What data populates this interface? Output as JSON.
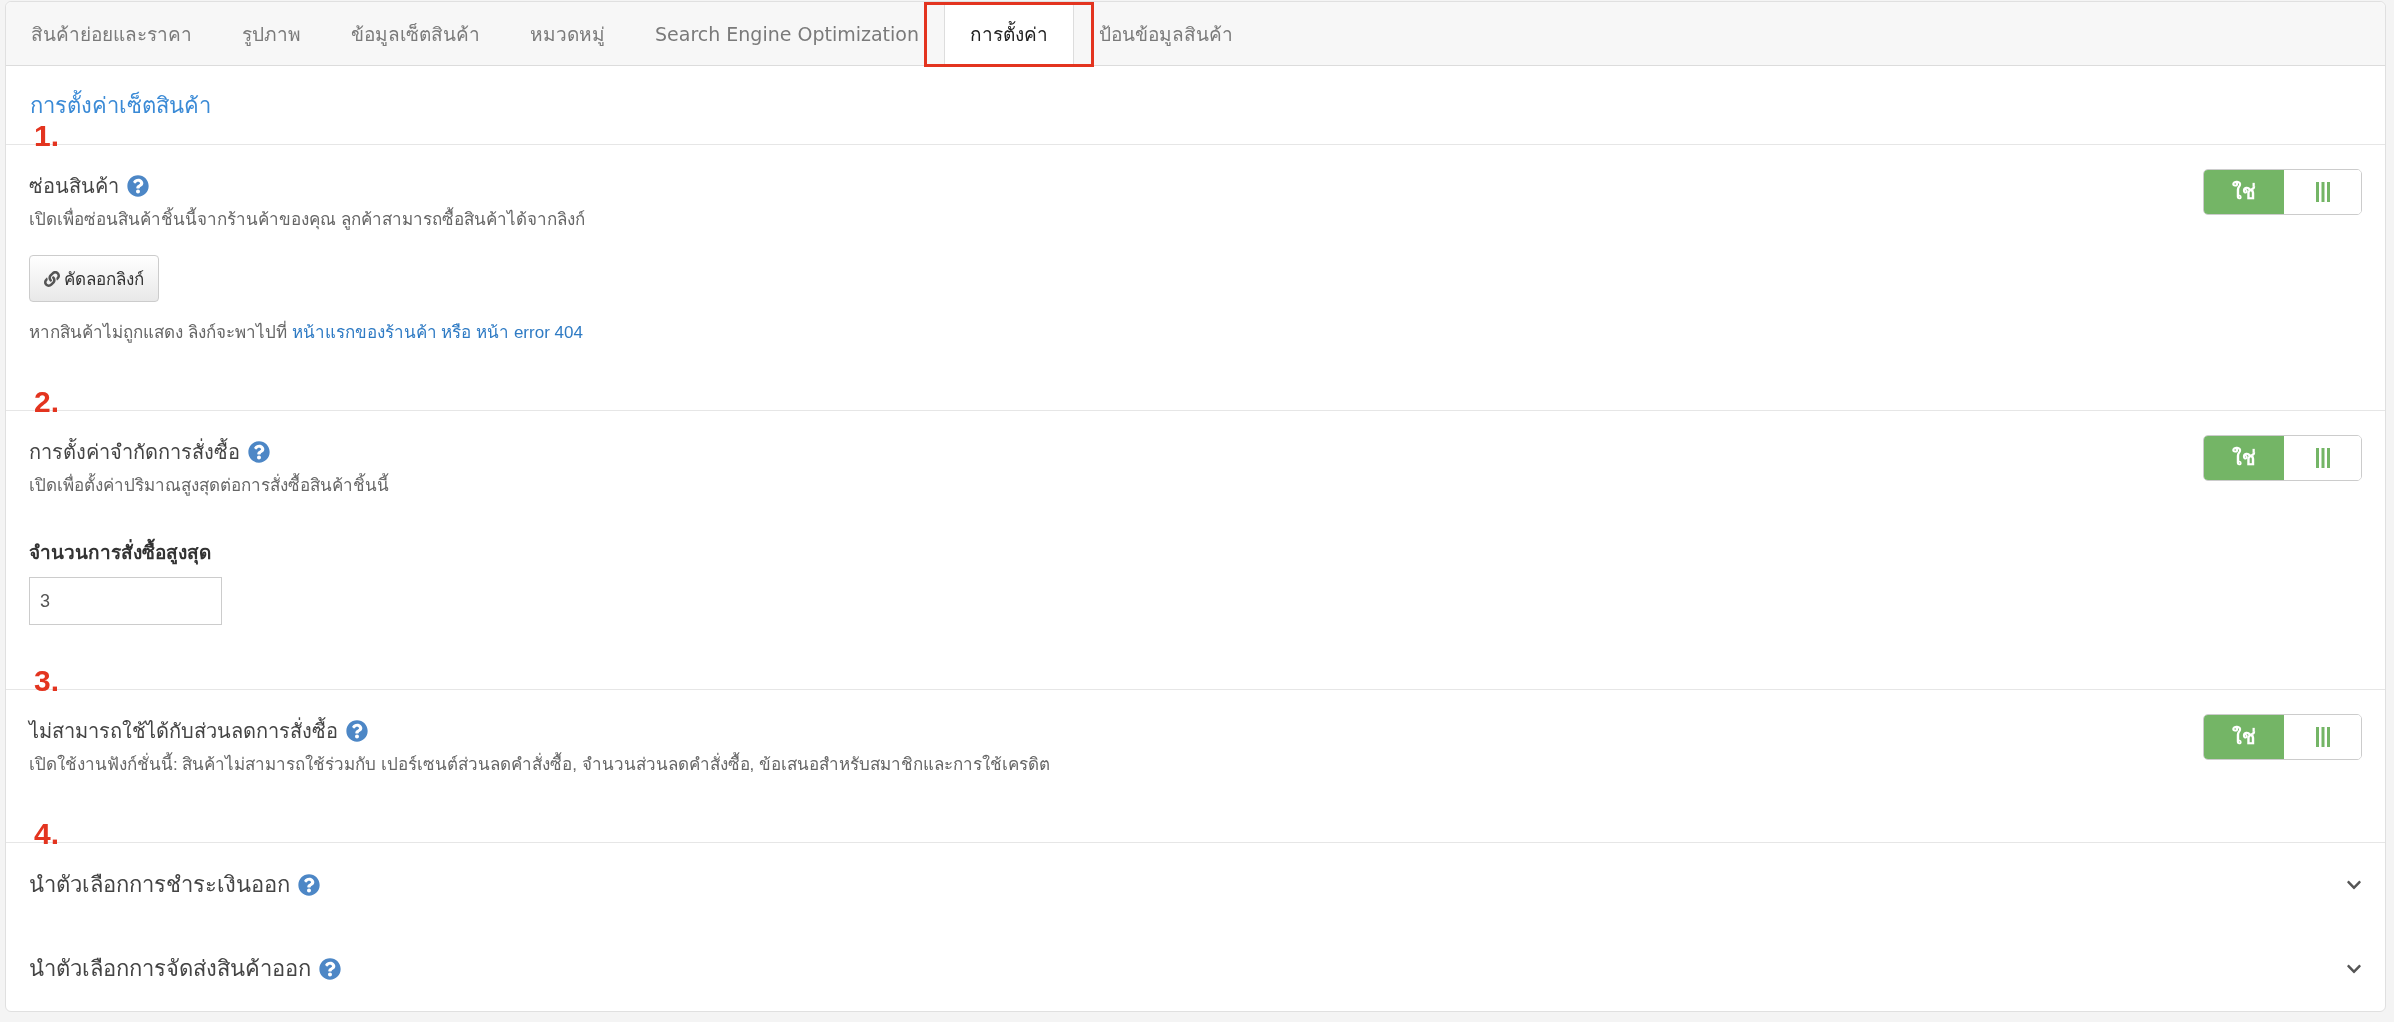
{
  "tabs": [
    {
      "label": "สินค้าย่อยและราคา",
      "selected": false,
      "highlighted": false
    },
    {
      "label": "รูปภาพ",
      "selected": false,
      "highlighted": false
    },
    {
      "label": "ข้อมูลเซ็ตสินค้า",
      "selected": false,
      "highlighted": false
    },
    {
      "label": "หมวดหมู่",
      "selected": false,
      "highlighted": false
    },
    {
      "label": "Search Engine Optimization",
      "selected": false,
      "highlighted": false
    },
    {
      "label": "การตั้งค่า",
      "selected": true,
      "highlighted": true
    },
    {
      "label": "ป้อนข้อมูลสินค้า",
      "selected": false,
      "highlighted": false
    }
  ],
  "panel_title": "การตั้งค่าเซ็ตสินค้า",
  "sections": [
    {
      "kind": "toggle",
      "marker": "1.",
      "title": "ซ่อนสินค้า",
      "description": "เปิดเพื่อซ่อนสินค้าชิ้นนี้จากร้านค้าของคุณ ลูกค้าสามารถซื้อสินค้าได้จากลิงก์",
      "toggle": {
        "label": "ใช่",
        "on": true
      },
      "button": {
        "label": "คัดลอกลิงก์"
      },
      "note": {
        "text": "หากสินค้าไม่ถูกแสดง ลิงก์จะพาไปที่",
        "link": "หน้าแรกของร้านค้า หรือ หน้า error 404"
      }
    },
    {
      "kind": "toggle",
      "marker": "2.",
      "title": "การตั้งค่าจำกัดการสั่งซื้อ",
      "description": "เปิดเพื่อตั้งค่าปริมาณสูงสุดต่อการสั่งซื้อสินค้าชิ้นนี้",
      "toggle": {
        "label": "ใช่",
        "on": true
      },
      "field": {
        "label": "จำนวนการสั่งซื้อสูงสุด",
        "value": "3"
      }
    },
    {
      "kind": "toggle",
      "marker": "3.",
      "title": "ไม่สามารถใช้ได้กับส่วนลดการสั่งซื้อ",
      "description": "เปิดใช้งานฟังก์ชั่นนี้: สินค้าไม่สามารถใช้ร่วมกับ เปอร์เซนต์ส่วนลดคำสั่งซื้อ, จำนวนส่วนลดคำสั่งซื้อ, ข้อเสนอสำหรับสมาชิกและการใช้เครดิต",
      "toggle": {
        "label": "ใช่",
        "on": true
      }
    },
    {
      "kind": "accordion",
      "marker": "4.",
      "items": [
        {
          "title": "นำตัวเลือกการชำระเงินออก",
          "expanded": false
        },
        {
          "title": "นำตัวเลือกการจัดส่งสินค้าออก",
          "expanded": false
        }
      ]
    }
  ]
}
